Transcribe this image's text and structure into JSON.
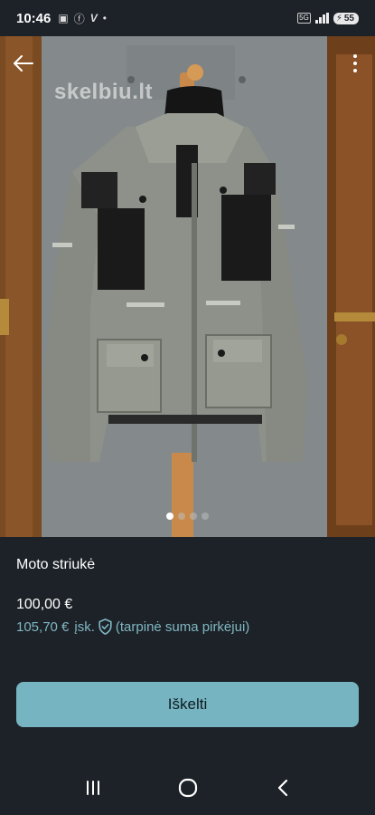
{
  "status_bar": {
    "time": "10:46",
    "battery": "55",
    "network_badge": "5G"
  },
  "listing": {
    "watermark": "skelbiu.lt",
    "image_count": 4,
    "active_image": 1,
    "title": "Moto striukė",
    "price": "100,00 €",
    "price_full": "105,70 €",
    "price_full_suffix": "įsk.",
    "price_full_note": "(tarpinė suma pirkėjui)"
  },
  "actions": {
    "cta_label": "Iškelti"
  },
  "icons": {
    "back": "arrow-left-icon",
    "more": "more-vertical-icon",
    "shield": "shield-check-icon",
    "nav_recents": "recents-icon",
    "nav_home": "home-icon",
    "nav_back": "back-chevron-icon"
  },
  "colors": {
    "background": "#1d2228",
    "accent": "#76b4c1",
    "price_full": "#7fb7c2"
  }
}
